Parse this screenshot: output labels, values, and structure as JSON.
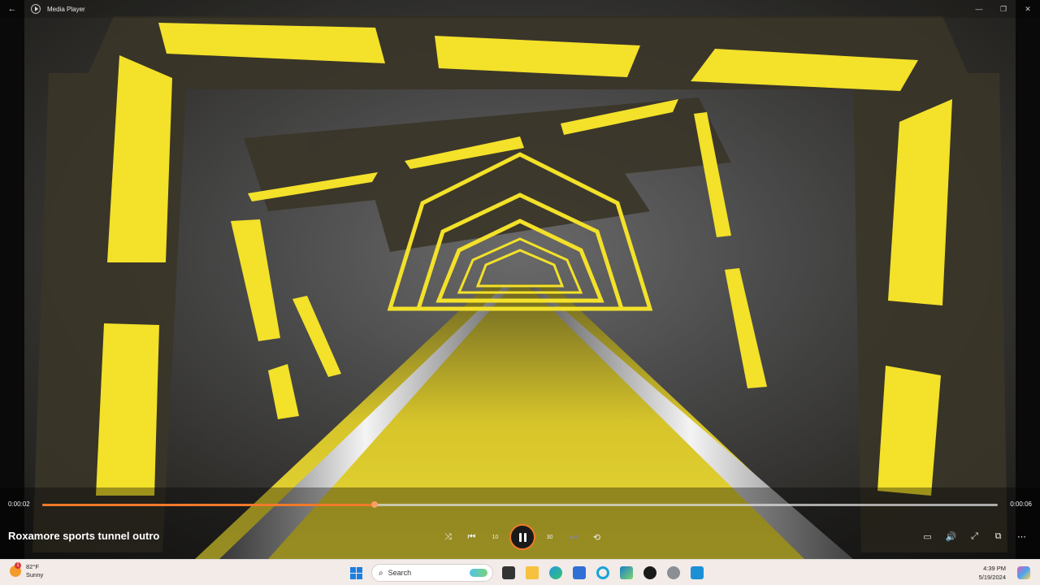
{
  "window": {
    "title": "Media Player",
    "back_icon": "back-arrow-icon",
    "minimize_glyph": "—",
    "maximize_glyph": "❐",
    "close_glyph": "✕"
  },
  "player": {
    "current_time": "0:00:02",
    "duration": "0:00:06",
    "progress": 0.348,
    "media_title": "Roxamore sports tunnel outro",
    "accent_color": "#f07a2a",
    "controls": {
      "shuffle_glyph": "⤨",
      "previous_glyph": "⏮",
      "rewind_label": "10",
      "forward_label": "30",
      "next_glyph": "⏭",
      "repeat_glyph": "⟲"
    },
    "right_controls": {
      "captions_glyph": "▭",
      "volume_glyph": "🔊",
      "fullscreen_glyph": "⤢",
      "miniplayer_glyph": "⧉",
      "more_glyph": "⋯"
    }
  },
  "taskbar": {
    "weather": {
      "temp": "82°F",
      "condition": "Sunny",
      "badge": "1"
    },
    "search_placeholder": "Search",
    "search_glyph": "⌕",
    "clock": {
      "time": "4:39 PM",
      "date": "5/19/2024"
    },
    "icons": [
      "windows-start-icon",
      "search-icon",
      "desktop-icon",
      "file-explorer-icon",
      "edge-icon",
      "store-icon",
      "cortana-icon",
      "visual-studio-icon",
      "media-player-icon",
      "settings-icon",
      "remote-desktop-icon",
      "copilot-icon"
    ]
  }
}
